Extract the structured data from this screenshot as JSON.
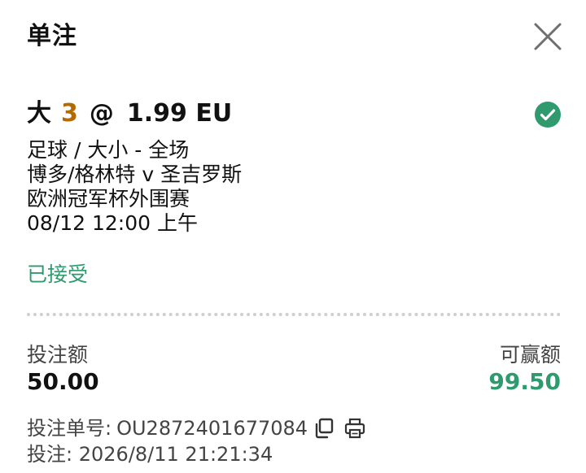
{
  "header": {
    "title": "单注"
  },
  "bet": {
    "selection": "大",
    "line": "3",
    "at_symbol": "@",
    "odds": "1.99 EU",
    "market": "足球 / 大小 - 全场",
    "event": "博多/格林特 v 圣吉罗斯",
    "competition": "欧洲冠军杯外围赛",
    "start_time": "08/12 12:00 上午",
    "status": "已接受"
  },
  "amounts": {
    "stake_label": "投注额",
    "stake_value": "50.00",
    "win_label": "可赢额",
    "win_value": "99.50"
  },
  "ticket": {
    "number_label": "投注单号:",
    "number_value": "OU2872401677084",
    "time_label": "投注:",
    "time_value": "2026/8/11 21:21:34"
  },
  "icons": {
    "close": "close-icon",
    "check": "check-circle-icon",
    "copy": "copy-icon",
    "print": "print-icon"
  },
  "colors": {
    "accent_green": "#2e9a6e",
    "line_orange": "#b36b00"
  }
}
